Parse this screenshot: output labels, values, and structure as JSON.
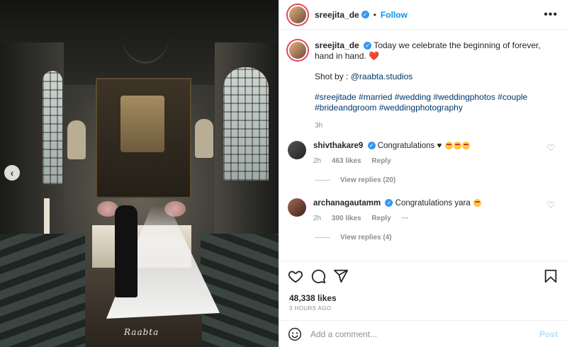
{
  "header": {
    "username": "sreejita_de",
    "verified_icon": "verified-badge-icon",
    "separator": "•",
    "follow_label": "Follow",
    "more_icon": "more-horizontal-icon"
  },
  "caption": {
    "username": "sreejita_de",
    "text": "Today we celebrate the beginning of forever, hand in hand.",
    "emoji": "❤️",
    "shot_by_label": "Shot by :",
    "shot_by_link": "@raabta.studios",
    "hashtags": "#sreejitade #married #wedding #weddingphotos #couple #brideandgroom #weddingphotography",
    "time": "3h"
  },
  "comments": [
    {
      "username": "shivthakare9",
      "text": "Congratulations ♥",
      "time": "2h",
      "likes": "463 likes",
      "reply_label": "Reply",
      "view_replies": "View replies (20)"
    },
    {
      "username": "archanagautamm",
      "text": "Congratulations yara",
      "time": "2h",
      "likes": "300 likes",
      "reply_label": "Reply",
      "more": "···",
      "view_replies": "View replies (4)"
    }
  ],
  "actions": {
    "like_icon": "heart-outline-icon",
    "comment_icon": "comment-icon",
    "share_icon": "send-icon",
    "save_icon": "bookmark-icon"
  },
  "stats": {
    "likes": "48,338 likes",
    "time_ago": "3 HOURS AGO"
  },
  "add_comment": {
    "emoji_icon": "smiley-icon",
    "placeholder": "Add a comment...",
    "post_label": "Post"
  },
  "photo": {
    "watermark": "Raabta",
    "prev_icon": "chevron-left-icon",
    "prev_glyph": "‹"
  },
  "colors": {
    "accent": "#0095f6",
    "link": "#00376b",
    "muted": "#8e8e8e"
  }
}
